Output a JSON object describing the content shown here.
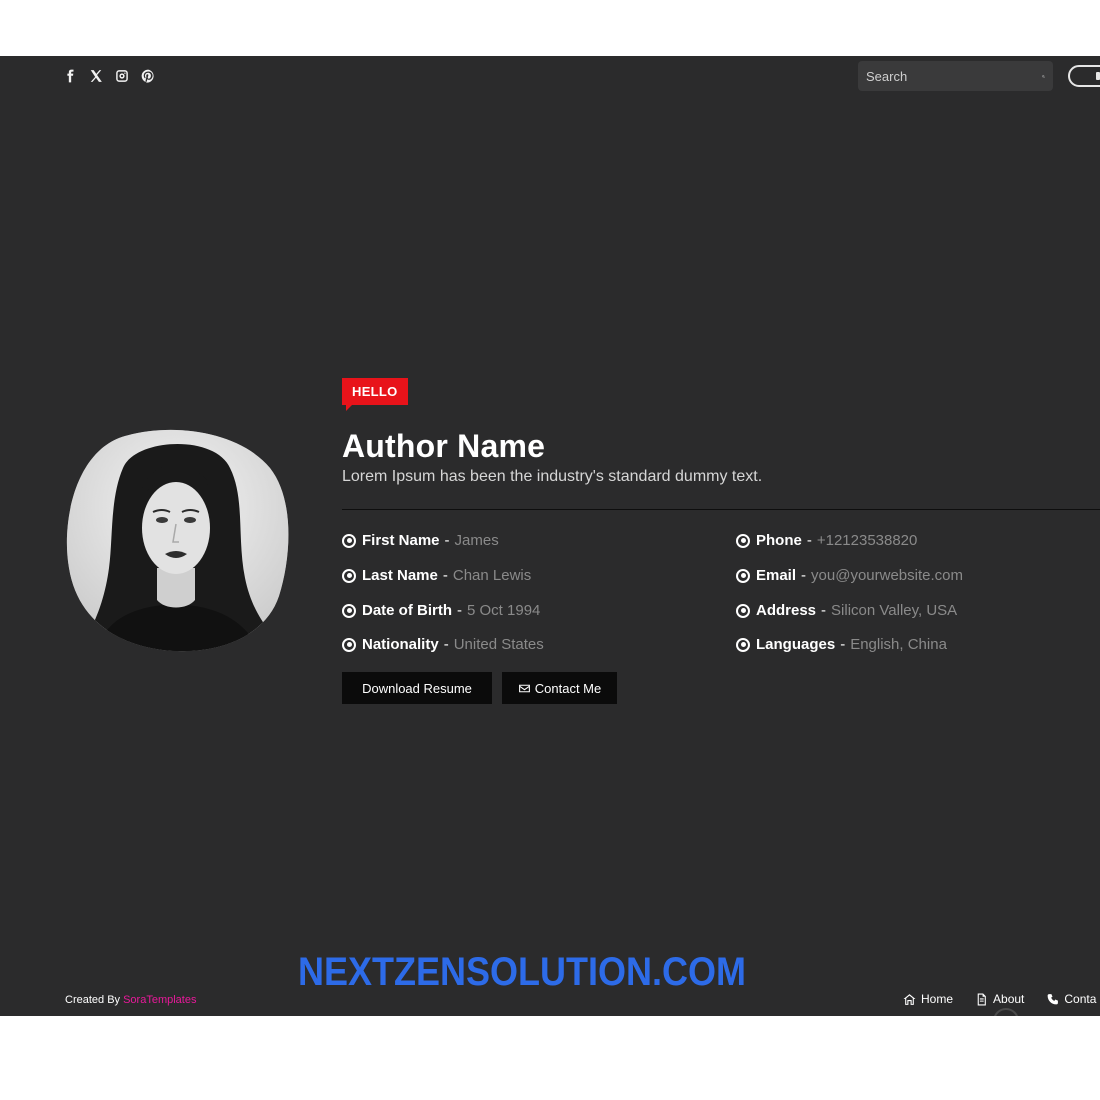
{
  "header": {
    "social_icons": [
      "facebook-icon",
      "x-twitter-icon",
      "instagram-icon",
      "pinterest-icon"
    ],
    "search_placeholder": "Search"
  },
  "profile": {
    "badge": "HELLO",
    "name": "Author Name",
    "description": "Lorem Ipsum has been the industry's standard dummy text.",
    "details_left": [
      {
        "label": "First Name",
        "value": "James"
      },
      {
        "label": "Last Name",
        "value": "Chan Lewis"
      },
      {
        "label": "Date of Birth",
        "value": "5 Oct 1994"
      },
      {
        "label": "Nationality",
        "value": "United States"
      }
    ],
    "details_right": [
      {
        "label": "Phone",
        "value": "+12123538820"
      },
      {
        "label": "Email",
        "value": "you@yourwebsite.com"
      },
      {
        "label": "Address",
        "value": "Silicon Valley, USA"
      },
      {
        "label": "Languages",
        "value": "English, China"
      }
    ],
    "download_label": "Download Resume",
    "contact_label": "Contact Me"
  },
  "footer": {
    "credit_prefix": "Created By",
    "credit_brand": "SoraTemplates",
    "watermark": "NEXTZENSOLUTION.COM",
    "nav": [
      {
        "label": "Home",
        "icon": "home-icon"
      },
      {
        "label": "About",
        "icon": "document-icon"
      },
      {
        "label": "Conta",
        "icon": "phone-icon"
      }
    ]
  },
  "colors": {
    "background": "#2b2b2c",
    "accent_red": "#e8131a",
    "brand_pink": "#e8199a",
    "watermark_blue": "#2d6be8"
  }
}
